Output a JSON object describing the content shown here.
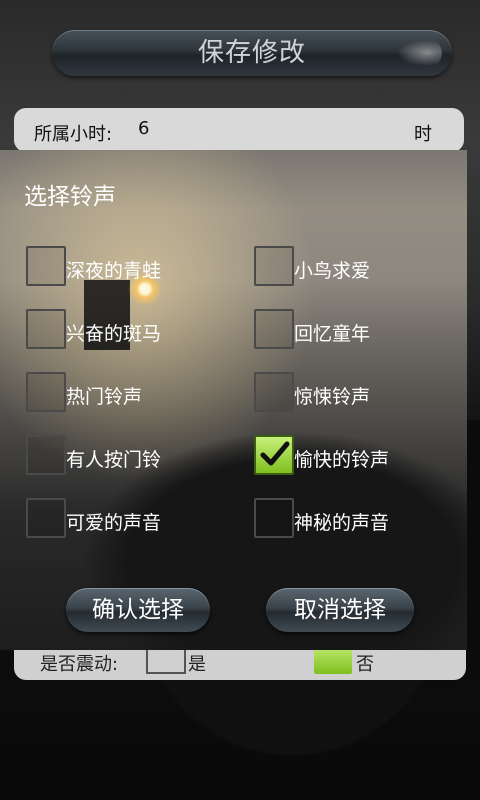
{
  "header": {
    "save_label": "保存修改"
  },
  "hour_field": {
    "label": "所属小时:",
    "value": "6",
    "unit": "时"
  },
  "dialog": {
    "title": "选择铃声",
    "options": [
      {
        "label": "深夜的青蛙",
        "checked": false
      },
      {
        "label": "小鸟求爱",
        "checked": false
      },
      {
        "label": "兴奋的斑马",
        "checked": false
      },
      {
        "label": "回忆童年",
        "checked": false
      },
      {
        "label": "热门铃声",
        "checked": false
      },
      {
        "label": "惊悚铃声",
        "checked": false
      },
      {
        "label": "有人按门铃",
        "checked": false
      },
      {
        "label": "愉快的铃声",
        "checked": true
      },
      {
        "label": "可爱的声音",
        "checked": false
      },
      {
        "label": "神秘的声音",
        "checked": false
      }
    ],
    "confirm_label": "确认选择",
    "cancel_label": "取消选择"
  },
  "vibration": {
    "label": "是否震动:",
    "yes_label": "是",
    "no_label": "否",
    "selected": "否"
  },
  "colors": {
    "check_green": "#7fbf1f",
    "button_dark": "#2d3439"
  }
}
